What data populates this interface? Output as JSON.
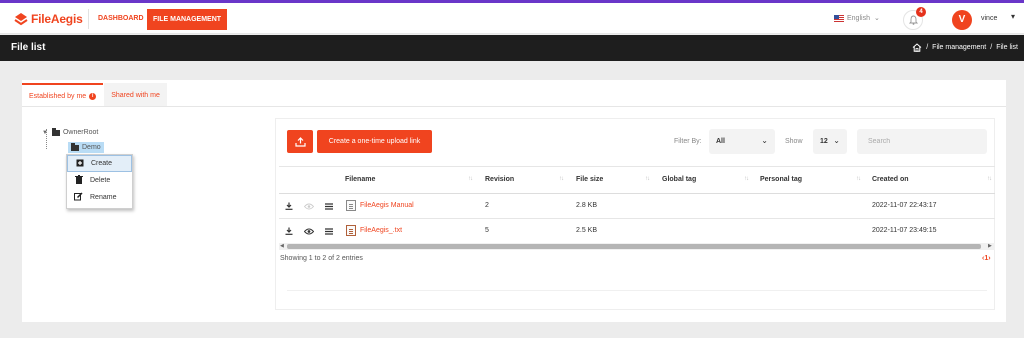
{
  "brand": {
    "name": "FileAegis",
    "color": "#f0441f"
  },
  "nav": {
    "dashboard": "DASHBOARD",
    "file_management": "FILE MANAGEMENT"
  },
  "header": {
    "language": "English",
    "notifications": "4",
    "avatar_initial": "V",
    "user_name": "vince"
  },
  "title_bar": {
    "title": "File list",
    "breadcrumb": [
      "File management",
      "File list"
    ],
    "separator": "/"
  },
  "tabs": [
    {
      "label": "Established by me",
      "active": true
    },
    {
      "label": "Shared with me",
      "active": false
    }
  ],
  "tree": {
    "root": "OwnerRoot",
    "child": "Demo"
  },
  "context_menu": [
    {
      "label": "Create",
      "icon": "plus-square-icon"
    },
    {
      "label": "Delete",
      "icon": "trash-icon"
    },
    {
      "label": "Rename",
      "icon": "edit-icon"
    }
  ],
  "toolbar": {
    "upload_icon": "upload-icon",
    "one_time_link": "Create a one-time upload link",
    "filter_label": "Filter By:",
    "filter_value": "All",
    "show_label": "Show",
    "show_value": "12",
    "search_placeholder": "Search"
  },
  "table": {
    "columns": [
      "Filename",
      "Revision",
      "File size",
      "Global tag",
      "Personal tag",
      "Created on"
    ],
    "rows": [
      {
        "filename": "FileAegis Manual",
        "revision": "2",
        "size": "2.8 KB",
        "global_tag": "",
        "personal_tag": "",
        "created": "2022-11-07 22:43:17",
        "preview_enabled": false
      },
      {
        "filename": "FileAegis_.txt",
        "revision": "5",
        "size": "2.5 KB",
        "global_tag": "",
        "personal_tag": "",
        "created": "2022-11-07 23:49:15",
        "preview_enabled": true
      }
    ]
  },
  "footer": {
    "info": "Showing 1 to 2 of 2 entries",
    "pager": "‹1›"
  }
}
